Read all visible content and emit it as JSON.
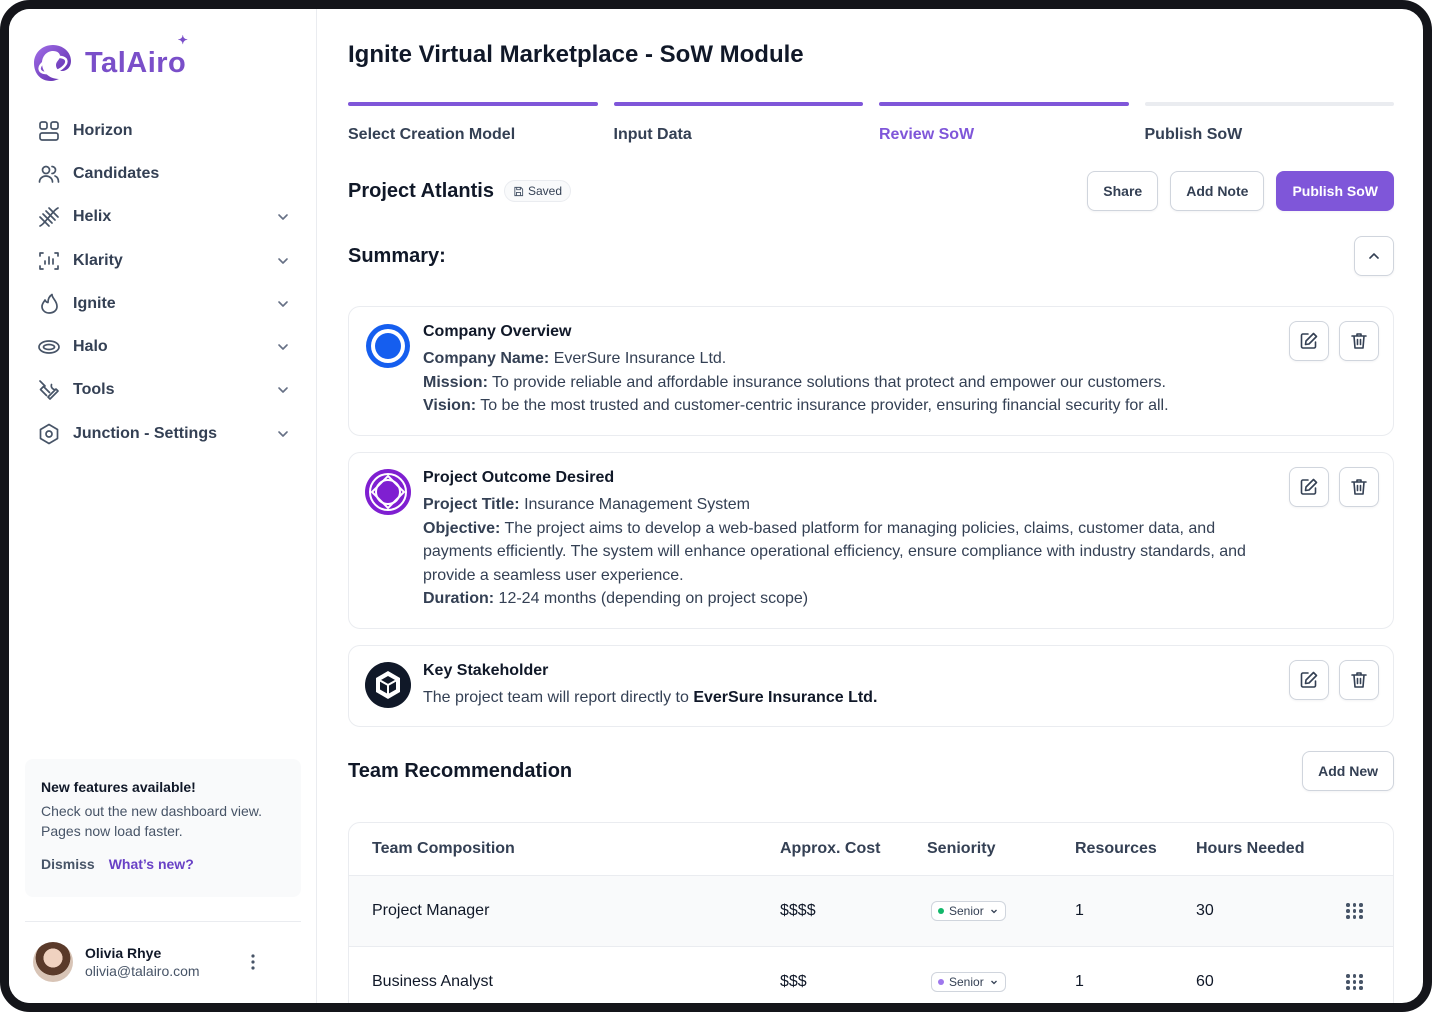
{
  "brand": {
    "name": "TalAiro"
  },
  "sidebar": {
    "items": [
      {
        "label": "Horizon",
        "icon": "grid-icon",
        "expandable": false
      },
      {
        "label": "Candidates",
        "icon": "users-icon",
        "expandable": false
      },
      {
        "label": "Helix",
        "icon": "dna-icon",
        "expandable": true
      },
      {
        "label": "Klarity",
        "icon": "scan-chart-icon",
        "expandable": true
      },
      {
        "label": "Ignite",
        "icon": "flame-icon",
        "expandable": true
      },
      {
        "label": "Halo",
        "icon": "halo-ring-icon",
        "expandable": true
      },
      {
        "label": "Tools",
        "icon": "tools-icon",
        "expandable": true
      },
      {
        "label": "Junction - Settings",
        "icon": "settings-hexagon-icon",
        "expandable": true
      }
    ],
    "promo": {
      "title": "New features available!",
      "line1": "Check out the new dashboard view.",
      "line2": "Pages now load faster.",
      "dismiss": "Dismiss",
      "whats_new": "What’s new?"
    },
    "user": {
      "name": "Olivia Rhye",
      "email": "olivia@talairo.com"
    }
  },
  "main": {
    "title": "Ignite Virtual Marketplace - SoW Module",
    "steps": [
      {
        "label": "Select Creation Model",
        "state": "complete"
      },
      {
        "label": "Input Data",
        "state": "complete"
      },
      {
        "label": "Review SoW",
        "state": "current"
      },
      {
        "label": "Publish SoW",
        "state": "inactive"
      }
    ],
    "project": {
      "title": "Project Atlantis",
      "badge": "Saved"
    },
    "buttons": {
      "share": "Share",
      "add_note": "Add Note",
      "publish": "Publish SoW"
    },
    "summary_title": "Summary:",
    "cards": [
      {
        "title": "Company Overview",
        "lines": [
          {
            "k": "Company Name:",
            "v": " EverSure Insurance Ltd."
          },
          {
            "k": "Mission:",
            "v": " To provide reliable and affordable insurance solutions that protect and empower our customers."
          },
          {
            "k": "Vision:",
            "v": " To be the most trusted and customer-centric insurance provider, ensuring financial security for all."
          }
        ]
      },
      {
        "title": "Project Outcome Desired",
        "lines": [
          {
            "k": "Project Title:",
            "v": " Insurance Management System"
          },
          {
            "k": "Objective:",
            "v": " The project aims to develop a web-based platform for managing policies, claims, customer data, and payments efficiently. The system will enhance operational efficiency, ensure compliance with industry standards, and provide a seamless user experience."
          },
          {
            "k": "Duration:",
            "v": " 12-24 months (depending on project scope)"
          }
        ]
      },
      {
        "title": "Key Stakeholder",
        "text": "The project team will report directly to ",
        "bold": "EverSure Insurance Ltd."
      }
    ],
    "team": {
      "title": "Team Recommendation",
      "add_new": "Add New",
      "columns": [
        "Team Composition",
        "Approx. Cost",
        "Seniority",
        "Resources",
        "Hours Needed"
      ],
      "rows": [
        {
          "role": "Project Manager",
          "cost": "$$$$",
          "seniority": "Senior",
          "dot": "#12b76a",
          "resources": "1",
          "hours": "30"
        },
        {
          "role": "Business Analyst",
          "cost": "$$$",
          "seniority": "Senior",
          "dot": "#9e77ed",
          "resources": "1",
          "hours": "60"
        }
      ]
    }
  }
}
